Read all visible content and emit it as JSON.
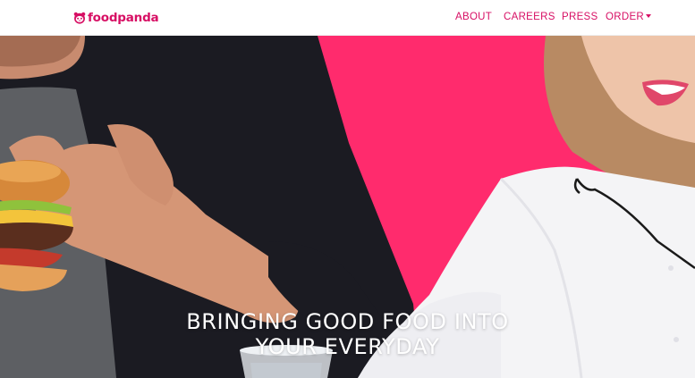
{
  "brand": {
    "name": "foodpanda",
    "color": "#d70f64",
    "logo_icon": "panda-icon"
  },
  "nav": {
    "color": "#d70f64",
    "items": [
      {
        "label": "ABOUT"
      },
      {
        "label": "CAREERS"
      },
      {
        "label": "PRESS"
      },
      {
        "label": "ORDER",
        "has_dropdown": true
      }
    ]
  },
  "hero": {
    "headline_line1": "BRINGING GOOD FOOD INTO",
    "headline_line2": "YOUR EVERYDAY",
    "background_color": "#ff2b6d",
    "image_description_icons": [
      "burger-icon",
      "water-glass-icon"
    ]
  }
}
